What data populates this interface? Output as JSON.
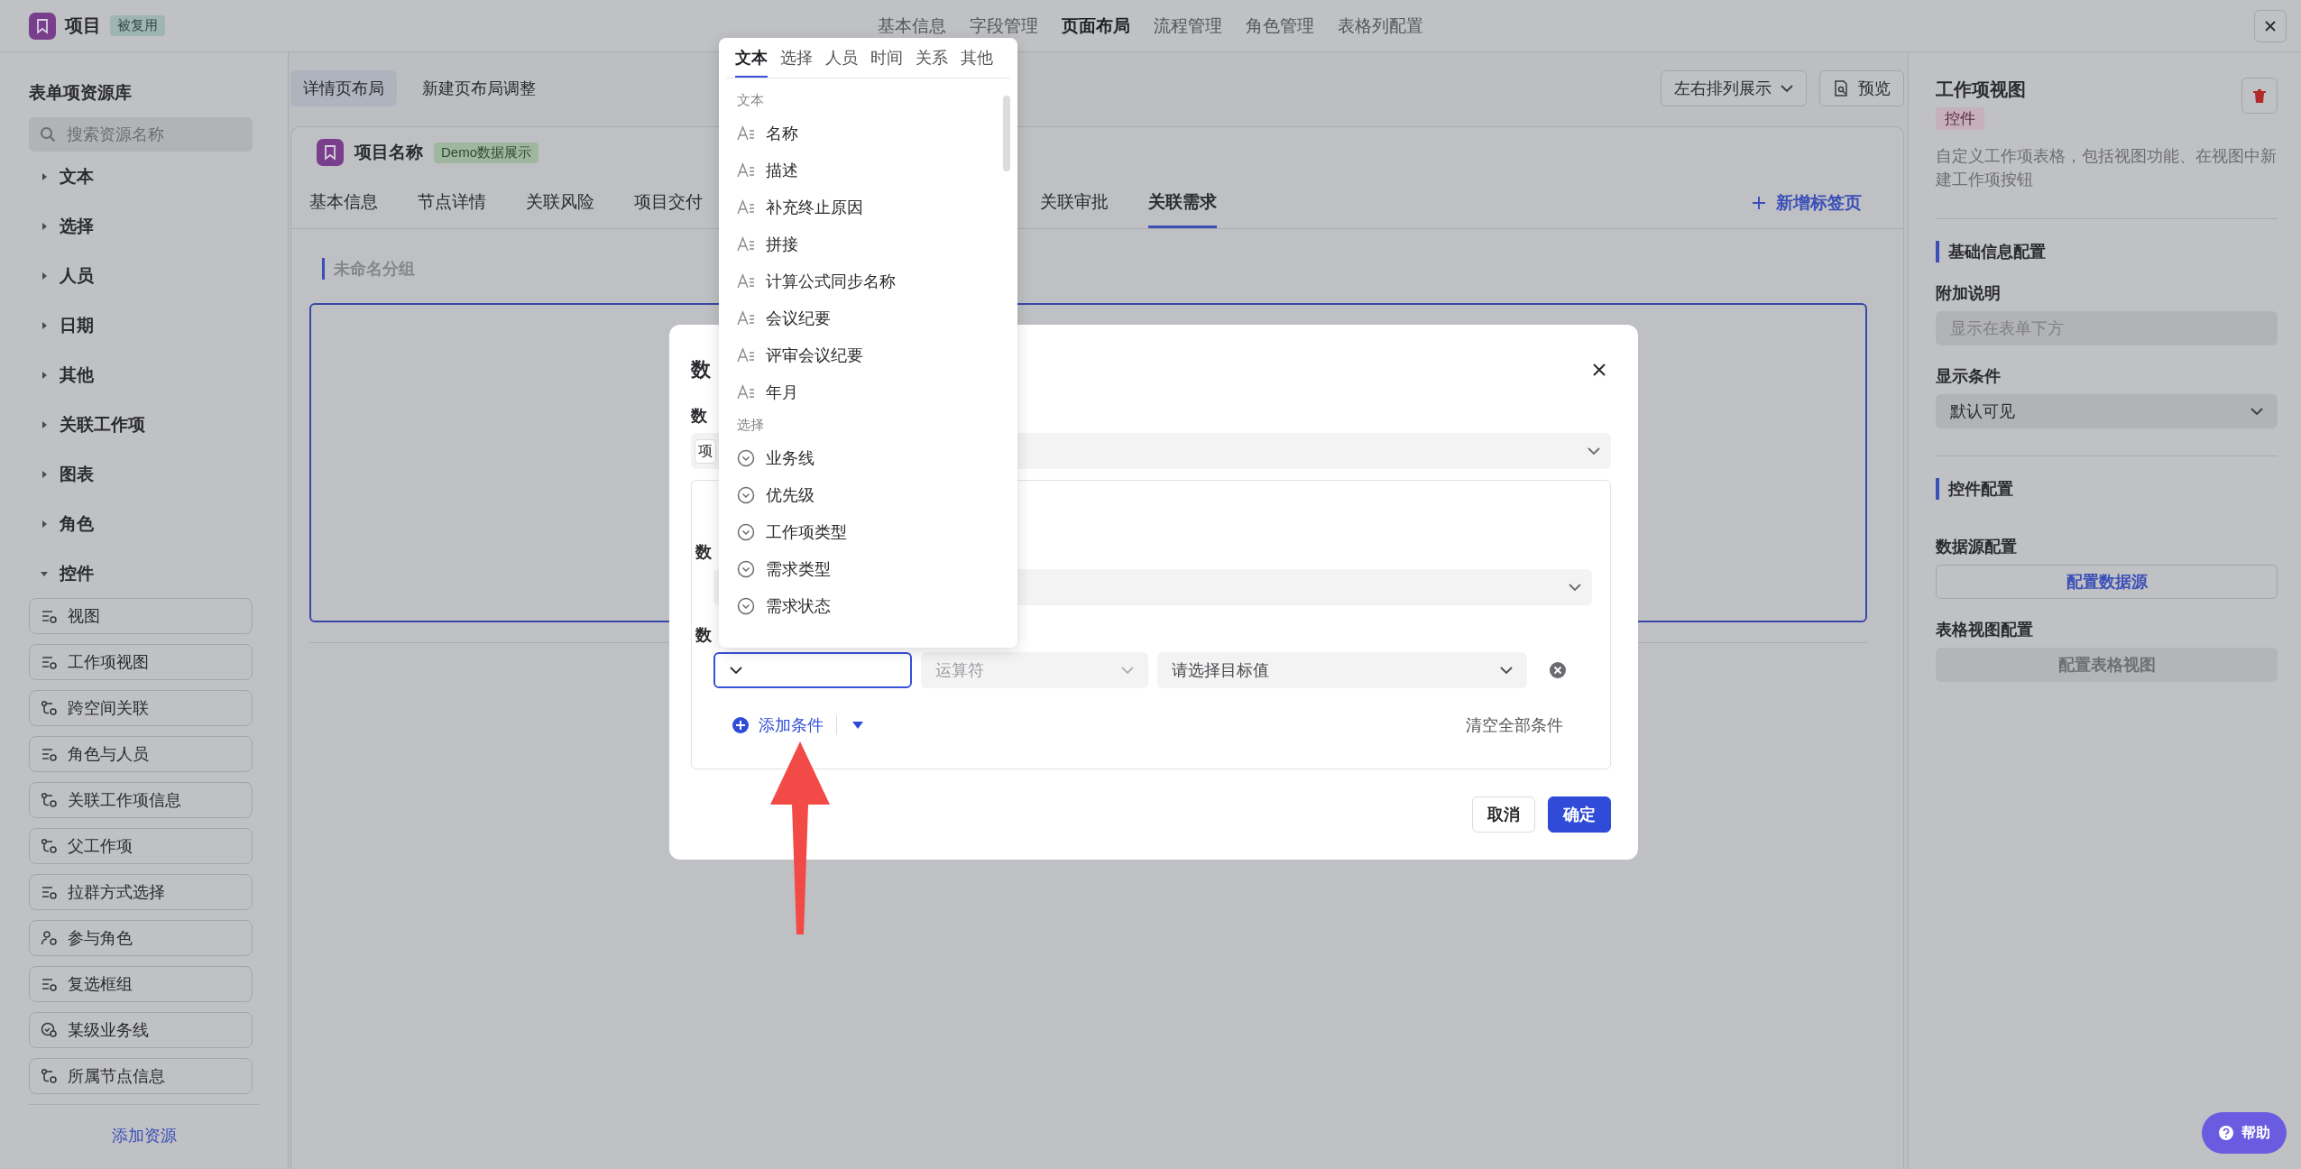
{
  "header": {
    "title": "项目",
    "badge": "被复用",
    "nav": [
      {
        "label": "基本信息",
        "selected": false
      },
      {
        "label": "字段管理",
        "selected": false
      },
      {
        "label": "页面布局",
        "selected": true
      },
      {
        "label": "流程管理",
        "selected": false
      },
      {
        "label": "角色管理",
        "selected": false
      },
      {
        "label": "表格列配置",
        "selected": false
      }
    ]
  },
  "sidebar": {
    "title": "表单项资源库",
    "search": {
      "placeholder": "搜索资源名称"
    },
    "groups": [
      {
        "label": "文本",
        "expanded": false
      },
      {
        "label": "选择",
        "expanded": false
      },
      {
        "label": "人员",
        "expanded": false
      },
      {
        "label": "日期",
        "expanded": false
      },
      {
        "label": "其他",
        "expanded": false
      },
      {
        "label": "关联工作项",
        "expanded": false
      },
      {
        "label": "图表",
        "expanded": false
      },
      {
        "label": "角色",
        "expanded": false
      },
      {
        "label": "控件",
        "expanded": true,
        "children": [
          {
            "label": "视图",
            "kind": "list"
          },
          {
            "label": "工作项视图",
            "kind": "list"
          },
          {
            "label": "跨空间关联",
            "kind": "branch"
          },
          {
            "label": "角色与人员",
            "kind": "list"
          },
          {
            "label": "关联工作项信息",
            "kind": "branch"
          },
          {
            "label": "父工作项",
            "kind": "branch"
          },
          {
            "label": "拉群方式选择",
            "kind": "list"
          },
          {
            "label": "参与角色",
            "kind": "person"
          },
          {
            "label": "复选框组",
            "kind": "list"
          },
          {
            "label": "某级业务线",
            "kind": "check"
          },
          {
            "label": "所属节点信息",
            "kind": "branch"
          }
        ]
      }
    ],
    "add_button": "添加资源"
  },
  "toolbar": {
    "layouts": [
      {
        "label": "详情页布局",
        "selected": true
      },
      {
        "label": "新建页布局调整",
        "selected": false
      }
    ],
    "arrange_select": "左右排列展示",
    "preview_button": "预览"
  },
  "card": {
    "title": "项目名称",
    "tag": "Demo数据展示",
    "tabs": [
      {
        "label": "基本信息",
        "selected": false
      },
      {
        "label": "节点详情",
        "selected": false
      },
      {
        "label": "关联风险",
        "selected": false
      },
      {
        "label": "项目交付",
        "selected": false
      },
      {
        "label": "关联审批",
        "selected": false
      },
      {
        "label": "关联需求",
        "selected": true
      }
    ],
    "add_tab": "新增标签页",
    "group_title": "未命名分组"
  },
  "properties": {
    "title": "工作项视图",
    "tag": "控件",
    "description": "自定义工作项表格，包括视图功能、在视图中新建工作项按钮",
    "basic_section": "基础信息配置",
    "note_label": "附加说明",
    "note_placeholder": "显示在表单下方",
    "condition_label": "显示条件",
    "condition_value": "默认可见",
    "control_section": "控件配置",
    "source_label": "数据源配置",
    "source_button": {
      "label": "配置数据源",
      "disabled": false
    },
    "table_label": "表格视图配置",
    "table_button": {
      "label": "配置表格视图",
      "disabled": true
    }
  },
  "modal": {
    "title": "数",
    "source_label": "数",
    "source_chip": "项",
    "inner_label_1": "数",
    "inner_label_2": "数",
    "operator_placeholder": "运算符",
    "target_placeholder": "请选择目标值",
    "add_condition": "添加条件",
    "clear_all": "清空全部条件",
    "cancel": "取消",
    "confirm": "确定"
  },
  "picker": {
    "tabs": [
      {
        "label": "文本",
        "selected": true
      },
      {
        "label": "选择",
        "selected": false
      },
      {
        "label": "人员",
        "selected": false
      },
      {
        "label": "时间",
        "selected": false
      },
      {
        "label": "关系",
        "selected": false
      },
      {
        "label": "其他",
        "selected": false
      }
    ],
    "sections": [
      {
        "heading": "文本",
        "kind": "text",
        "items": [
          "名称",
          "描述",
          "补充终止原因",
          "拼接",
          "计算公式同步名称",
          "会议纪要",
          "评审会议纪要",
          "年月"
        ]
      },
      {
        "heading": "选择",
        "kind": "select",
        "items": [
          "业务线",
          "优先级",
          "工作项类型",
          "需求类型",
          "需求状态"
        ]
      }
    ]
  },
  "help_button": "帮助"
}
